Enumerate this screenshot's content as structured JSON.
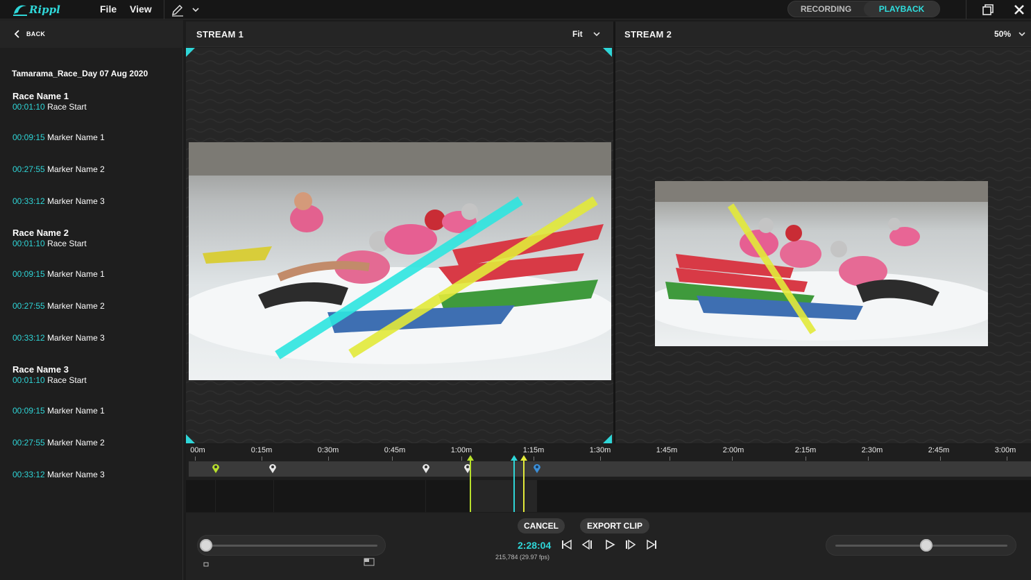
{
  "app": {
    "logo_text": "Rippl"
  },
  "menu": {
    "file": "File",
    "view": "View"
  },
  "mode": {
    "recording": "RECORDING",
    "playback": "PLAYBACK",
    "active": "PLAYBACK"
  },
  "sidebar": {
    "back_label": "BACK",
    "session_title": "Tamarama_Race_Day 07 Aug 2020",
    "races": [
      {
        "name": "Race Name 1",
        "markers": [
          {
            "time": "00:01:10",
            "label": "Race Start"
          },
          {
            "time": "00:09:15",
            "label": "Marker Name 1"
          },
          {
            "time": "00:27:55",
            "label": "Marker Name 2"
          },
          {
            "time": "00:33:12",
            "label": "Marker Name 3"
          }
        ]
      },
      {
        "name": "Race Name 2",
        "markers": [
          {
            "time": "00:01:10",
            "label": "Race Start"
          },
          {
            "time": "00:09:15",
            "label": "Marker Name 1"
          },
          {
            "time": "00:27:55",
            "label": "Marker Name 2"
          },
          {
            "time": "00:33:12",
            "label": "Marker Name 3"
          }
        ]
      },
      {
        "name": "Race Name 3",
        "markers": [
          {
            "time": "00:01:10",
            "label": "Race Start"
          },
          {
            "time": "00:09:15",
            "label": "Marker Name 1"
          },
          {
            "time": "00:27:55",
            "label": "Marker Name 2"
          },
          {
            "time": "00:33:12",
            "label": "Marker Name 3"
          }
        ]
      }
    ]
  },
  "stream1": {
    "title": "STREAM 1",
    "zoom": "Fit"
  },
  "stream2": {
    "title": "STREAM 2",
    "zoom": "50%"
  },
  "timeline": {
    "ticks": [
      "00m",
      "0:15m",
      "0:30m",
      "0:45m",
      "1:00m",
      "1:15m",
      "1:30m",
      "1:45m",
      "2:00m",
      "2:15m",
      "2:30m",
      "2:45m",
      "3:00m"
    ]
  },
  "controls": {
    "cancel_label": "CANCEL",
    "export_label": "EXPORT CLIP",
    "timecode": "2:28:04",
    "frames": "215,784 (29.97 fps)"
  },
  "colors": {
    "accent": "#2fd6d8",
    "annotation_cyan": "#2ee6e0",
    "annotation_yellow": "#e3ea3a",
    "marker_green": "#b8e02c",
    "marker_blue": "#3b8fd9"
  }
}
